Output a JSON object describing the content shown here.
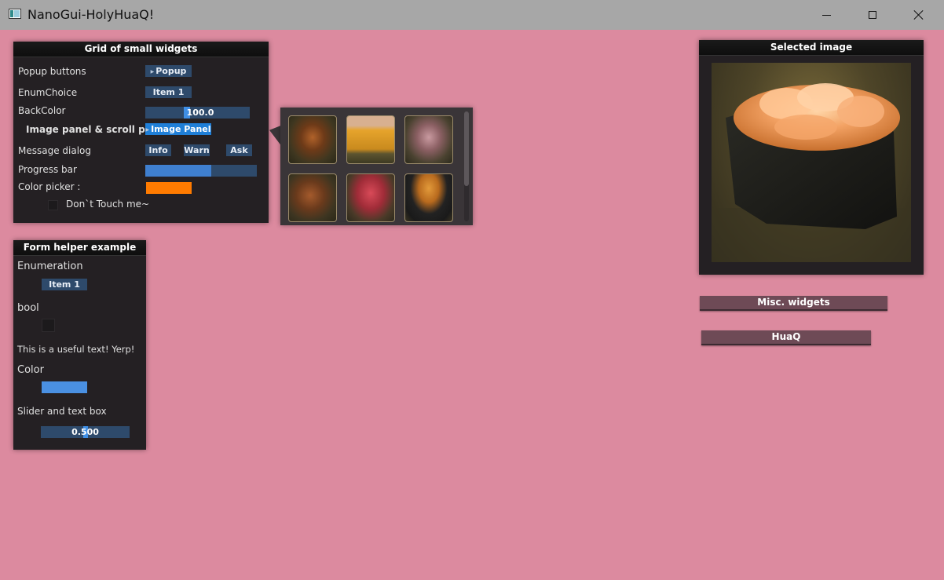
{
  "titlebar": {
    "title": "NanoGui-HolyHuaQ!"
  },
  "grid_window": {
    "title": "Grid of small widgets",
    "popup_label": "Popup buttons",
    "popup_button": "Popup",
    "enum_label": "EnumChoice",
    "enum_value": "Item 1",
    "backcolor_label": "BackColor",
    "backcolor_value": "100.0",
    "image_panel_label": "Image panel & scroll panel",
    "image_panel_button": "Image Panel",
    "message_label": "Message dialog",
    "info": "Info",
    "warn": "Warn",
    "ask": "Ask",
    "progress_label": "Progress bar",
    "progress_fraction": 0.59,
    "color_picker_label": "Color picker :",
    "color_picker_value": "#ff7b00",
    "dont_touch": "Don`t Touch me~"
  },
  "image_popup": {
    "thumbnails": [
      "sushi-eel-icon",
      "tamago-icon",
      "sushi-fish-icon",
      "sushi-grilled-icon",
      "sushi-tuna-icon",
      "sushi-uni-icon"
    ]
  },
  "form_window": {
    "title": "Form helper example",
    "enumeration_label": "Enumeration",
    "enumeration_value": "Item 1",
    "bool_label": "bool",
    "text_value": "This is a useful text! Yerp!",
    "color_label": "Color",
    "color_value": "#4a90e2",
    "slider_label": "Slider and text box",
    "slider_value": "0.500",
    "slider_fraction": 0.5
  },
  "selected_window": {
    "title": "Selected image"
  },
  "misc_button": "Misc. widgets",
  "huaq_button": "HuaQ"
}
